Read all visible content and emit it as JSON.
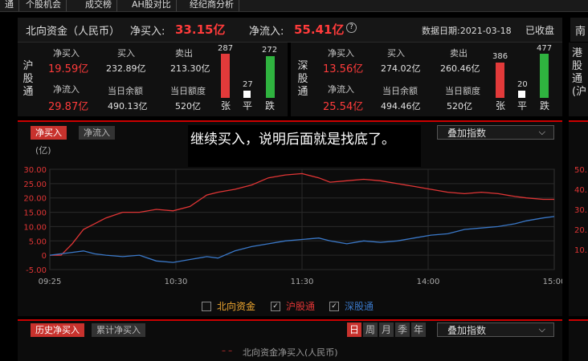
{
  "nav": {
    "tabs": [
      "通",
      "个股机会",
      "成交榜",
      "AH股对比",
      "经纪商分析"
    ]
  },
  "header": {
    "title": "北向资金（人民币）",
    "net_buy_label": "净买入:",
    "net_buy_value": "33.15亿",
    "net_inflow_label": "净流入:",
    "net_inflow_value": "55.41亿",
    "help_icon": "?",
    "date_label": "数据日期:2021-03-18",
    "status": "已收盘",
    "right_cut": "南"
  },
  "sh": {
    "name_chars": [
      "沪",
      "股",
      "通"
    ],
    "net_buy_label": "净买入",
    "net_buy_value": "19.59亿",
    "buy_label": "买入",
    "buy_value": "232.89亿",
    "sell_label": "卖出",
    "sell_value": "213.30亿",
    "net_inflow_label": "净流入",
    "net_inflow_value": "29.87亿",
    "balance_label": "当日余额",
    "balance_value": "490.13亿",
    "quota_label": "当日额度",
    "quota_value": "520亿",
    "up_count": "287",
    "flat_count": "27",
    "down_count": "272",
    "up_label": "张",
    "flat_label": "平",
    "down_label": "跌"
  },
  "sz": {
    "name_chars": [
      "深",
      "股",
      "通"
    ],
    "net_buy_label": "净买入",
    "net_buy_value": "13.56亿",
    "buy_label": "买入",
    "buy_value": "274.02亿",
    "sell_label": "卖出",
    "sell_value": "260.46亿",
    "net_inflow_label": "净流入",
    "net_inflow_value": "25.54亿",
    "balance_label": "当日余额",
    "balance_value": "494.46亿",
    "quota_label": "当日额度",
    "quota_value": "520亿",
    "up_count": "386",
    "flat_count": "20",
    "down_count": "477",
    "up_label": "张",
    "flat_label": "平",
    "down_label": "跌"
  },
  "right_hk": {
    "name_chars": [
      "港",
      "股",
      "通",
      "(沪"
    ]
  },
  "chart_tabs": {
    "net_buy": "净买入",
    "net_inflow": "净流入"
  },
  "overlay_select": "叠加指数",
  "tooltip": "继续买入，说明后面就是找底了。",
  "legend": {
    "north": "北向资金",
    "sh": "沪股通",
    "sz": "深股通",
    "check": "✓"
  },
  "right_axis": [
    "50.",
    "40.",
    "30.",
    "20.",
    "10."
  ],
  "bottom": {
    "hist_tab": "历史净买入",
    "cum_tab": "累计净买入",
    "periods": [
      "日",
      "周",
      "月",
      "季",
      "年"
    ],
    "select": "叠加指数",
    "legend_text": "北向资金净买入(人民币)"
  },
  "colors": {
    "red": "#e03535",
    "blue": "#3a78c8",
    "up": "#e23a3a",
    "down": "#2fb33f"
  },
  "chart_data": {
    "type": "line",
    "ylabel": "(亿)",
    "y_ticks": [
      "30.00",
      "25.00",
      "20.00",
      "15.00",
      "10.00",
      "5.00",
      "0",
      "-5.00"
    ],
    "x_ticks": [
      "09:25",
      "10:30",
      "11:30",
      "14:00",
      "15:00"
    ],
    "ylim": [
      -5,
      30
    ],
    "grid": true,
    "series": [
      {
        "name": "沪股通",
        "color": "#e03535",
        "values": [
          [
            0,
            0
          ],
          [
            4,
            0
          ],
          [
            8,
            4
          ],
          [
            12,
            9
          ],
          [
            16,
            11
          ],
          [
            20,
            13
          ],
          [
            26,
            15
          ],
          [
            32,
            15
          ],
          [
            38,
            16
          ],
          [
            44,
            15.5
          ],
          [
            50,
            17
          ],
          [
            56,
            21
          ],
          [
            60,
            22
          ],
          [
            66,
            23
          ],
          [
            72,
            24.5
          ],
          [
            78,
            27
          ],
          [
            84,
            28
          ],
          [
            90,
            28.5
          ],
          [
            96,
            27
          ],
          [
            100,
            25.5
          ],
          [
            106,
            26
          ],
          [
            112,
            26.5
          ],
          [
            118,
            26
          ],
          [
            124,
            25
          ],
          [
            130,
            24
          ],
          [
            136,
            23
          ],
          [
            142,
            22
          ],
          [
            148,
            21.5
          ],
          [
            154,
            22
          ],
          [
            160,
            21.5
          ],
          [
            166,
            20.5
          ],
          [
            170,
            20
          ],
          [
            176,
            19.5
          ],
          [
            180,
            19.5
          ]
        ]
      },
      {
        "name": "深股通",
        "color": "#3a78c8",
        "values": [
          [
            0,
            0
          ],
          [
            4,
            0.5
          ],
          [
            8,
            1
          ],
          [
            12,
            1.5
          ],
          [
            16,
            0.5
          ],
          [
            20,
            0
          ],
          [
            26,
            -0.5
          ],
          [
            32,
            0
          ],
          [
            38,
            -2
          ],
          [
            44,
            -2.5
          ],
          [
            50,
            -1.5
          ],
          [
            56,
            -0.5
          ],
          [
            60,
            -1
          ],
          [
            66,
            1.5
          ],
          [
            72,
            3
          ],
          [
            78,
            4
          ],
          [
            84,
            5
          ],
          [
            90,
            5.5
          ],
          [
            96,
            6
          ],
          [
            100,
            5
          ],
          [
            106,
            4
          ],
          [
            112,
            5
          ],
          [
            118,
            4.5
          ],
          [
            124,
            5
          ],
          [
            130,
            6
          ],
          [
            136,
            7
          ],
          [
            142,
            7.5
          ],
          [
            148,
            9
          ],
          [
            154,
            9.5
          ],
          [
            160,
            10
          ],
          [
            166,
            11
          ],
          [
            170,
            12
          ],
          [
            176,
            13
          ],
          [
            180,
            13.5
          ]
        ]
      }
    ]
  }
}
